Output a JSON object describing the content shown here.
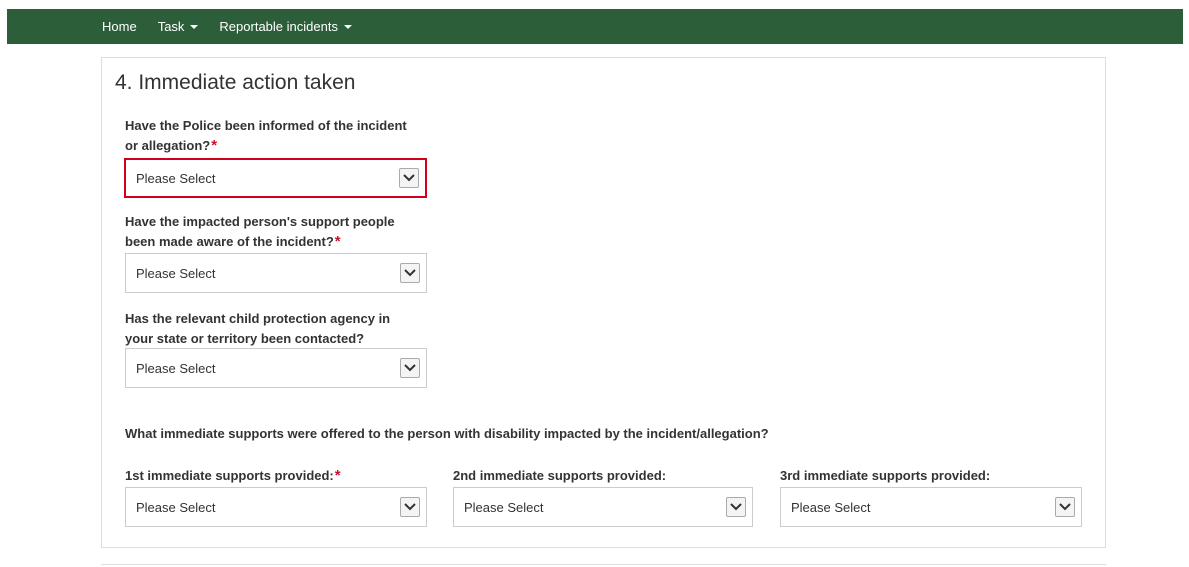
{
  "nav": {
    "items": [
      {
        "label": "Home",
        "has_dropdown": false
      },
      {
        "label": "Task",
        "has_dropdown": true
      },
      {
        "label": "Reportable incidents",
        "has_dropdown": true
      }
    ],
    "background": "#2c5e3a"
  },
  "section": {
    "title": "4. Immediate action taken"
  },
  "questions": {
    "police": {
      "line1": "Have the Police been informed of the incident",
      "line2": "or allegation?",
      "required_mark": "*",
      "value": "Please Select"
    },
    "support_people": {
      "line1": "Have the impacted person's support people",
      "line2": "been made aware of the incident?",
      "required_mark": "*",
      "value": "Please Select"
    },
    "child_protection": {
      "line1": "Has the relevant child protection agency in",
      "line2": "your state or territory been contacted?",
      "value": "Please Select"
    },
    "supports_intro": "What immediate supports were offered to the person with disability impacted by the incident/allegation?",
    "support_1": {
      "label": "1st immediate supports provided:",
      "required_mark": "*",
      "value": "Please Select"
    },
    "support_2": {
      "label": "2nd immediate supports provided:",
      "value": "Please Select"
    },
    "support_3": {
      "label": "3rd immediate supports provided:",
      "value": "Please Select"
    }
  },
  "colors": {
    "required": "#c8102e",
    "error_border": "#d0021b"
  }
}
